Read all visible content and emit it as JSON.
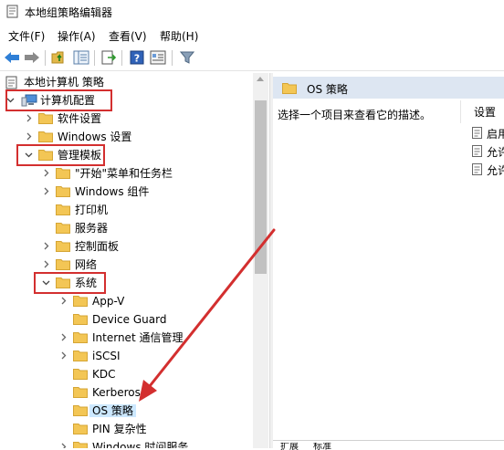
{
  "window": {
    "title": "本地组策略编辑器"
  },
  "menu": [
    "文件(F)",
    "操作(A)",
    "查看(V)",
    "帮助(H)"
  ],
  "toolbar": {
    "buttons": [
      "back-arrow-icon",
      "forward-arrow-icon",
      "up-folder-icon",
      "show-hide-tree-icon",
      "export-list-icon",
      "help-icon",
      "properties-icon",
      "filter-icon"
    ]
  },
  "tree": {
    "root": "本地计算机 策略",
    "computer_config": "计算机配置",
    "items": [
      {
        "label": "软件设置"
      },
      {
        "label": "Windows 设置"
      },
      {
        "label": "管理模板"
      },
      {
        "label": "\"开始\"菜单和任务栏"
      },
      {
        "label": "Windows 组件"
      },
      {
        "label": "打印机"
      },
      {
        "label": "服务器"
      },
      {
        "label": "控制面板"
      },
      {
        "label": "网络"
      },
      {
        "label": "系统"
      },
      {
        "label": "App-V"
      },
      {
        "label": "Device Guard"
      },
      {
        "label": "Internet 通信管理"
      },
      {
        "label": "iSCSI"
      },
      {
        "label": "KDC"
      },
      {
        "label": "Kerberos"
      },
      {
        "label": "OS 策略"
      },
      {
        "label": "PIN 复杂性"
      },
      {
        "label": "Windows 时间服务"
      }
    ]
  },
  "right": {
    "title": "OS 策略",
    "description": "选择一个项目来查看它的描述。",
    "setting_header": "设置",
    "settings": [
      "启用",
      "允许",
      "允许"
    ]
  },
  "bottom_tabs": [
    "扩展",
    "标准"
  ],
  "colors": {
    "highlight": "#d32f2f",
    "selection": "#cce8ff",
    "header_band": "#dde6f2",
    "folder": "#f3c655"
  }
}
